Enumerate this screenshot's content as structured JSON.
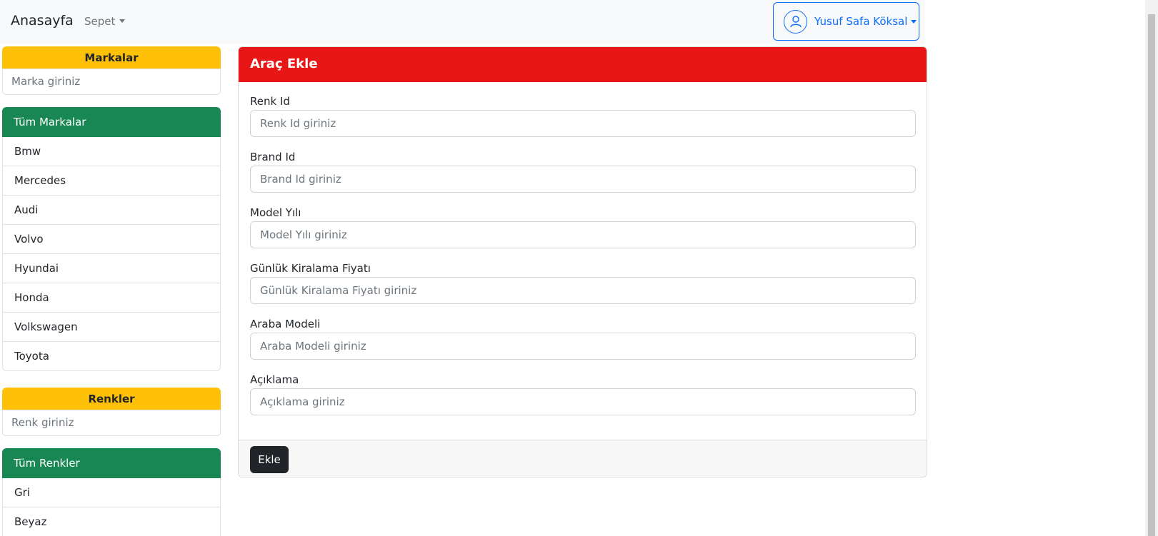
{
  "navbar": {
    "brand": "Anasayfa",
    "cart": "Sepet",
    "user_name": "Yusuf Safa Köksal"
  },
  "sidebar": {
    "brands_header": "Markalar",
    "brands_filter_placeholder": "Marka giriniz",
    "all_brands": "Tüm Markalar",
    "brands": [
      "Bmw",
      "Mercedes",
      "Audi",
      "Volvo",
      "Hyundai",
      "Honda",
      "Volkswagen",
      "Toyota"
    ],
    "colors_header": "Renkler",
    "colors_filter_placeholder": "Renk giriniz",
    "all_colors": "Tüm Renkler",
    "colors": [
      "Gri",
      "Beyaz"
    ]
  },
  "form": {
    "title": "Araç Ekle",
    "fields": [
      {
        "label": "Renk Id",
        "placeholder": "Renk Id giriniz"
      },
      {
        "label": "Brand Id",
        "placeholder": "Brand Id giriniz"
      },
      {
        "label": "Model Yılı",
        "placeholder": "Model Yılı giriniz"
      },
      {
        "label": "Günlük Kiralama Fiyatı",
        "placeholder": "Günlük Kiralama Fiyatı giriniz"
      },
      {
        "label": "Araba Modeli",
        "placeholder": "Araba Modeli giriniz"
      },
      {
        "label": "Açıklama",
        "placeholder": "Açıklama giriniz"
      }
    ],
    "submit_label": "Ekle"
  },
  "colors": {
    "header_red": "#e91616",
    "accent_yellow": "#ffc107",
    "accent_green": "#198754",
    "primary_blue": "#0d6efd"
  }
}
